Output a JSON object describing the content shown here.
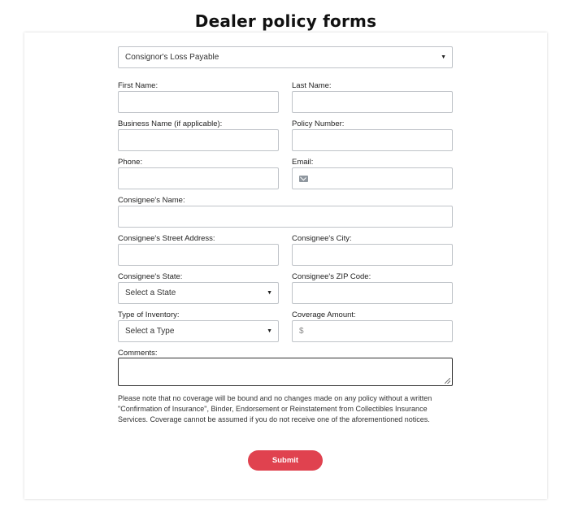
{
  "page": {
    "title": "Dealer policy forms"
  },
  "form": {
    "policy_type": {
      "selected": "Consignor's Loss Payable"
    },
    "first_name": {
      "label": "First Name:"
    },
    "last_name": {
      "label": "Last Name:"
    },
    "business_name": {
      "label": "Business Name (if applicable):"
    },
    "policy_number": {
      "label": "Policy Number:"
    },
    "phone": {
      "label": "Phone:"
    },
    "email": {
      "label": "Email:",
      "icon": "envelope-icon"
    },
    "consignee_name": {
      "label": "Consignee's Name:"
    },
    "consignee_street": {
      "label": "Consignee's Street Address:"
    },
    "consignee_city": {
      "label": "Consignee's City:"
    },
    "consignee_state": {
      "label": "Consignee's State:",
      "selected": "Select a State"
    },
    "consignee_zip": {
      "label": "Consignee's ZIP Code:"
    },
    "inventory_type": {
      "label": "Type of Inventory:",
      "selected": "Select a Type"
    },
    "coverage_amount": {
      "label": "Coverage Amount:",
      "prefix": "$"
    },
    "comments": {
      "label": "Comments:"
    },
    "notice": "Please note that no coverage will be bound and no changes made on any policy without a written \"Confirmation of Insurance\", Binder, Endorsement or Reinstatement from Collectibles Insurance Services. Coverage cannot be assumed if you do not receive one of the aforementioned notices.",
    "submit_label": "Submit"
  },
  "colors": {
    "accent": "#e0424f",
    "border": "#bfc3c8"
  }
}
